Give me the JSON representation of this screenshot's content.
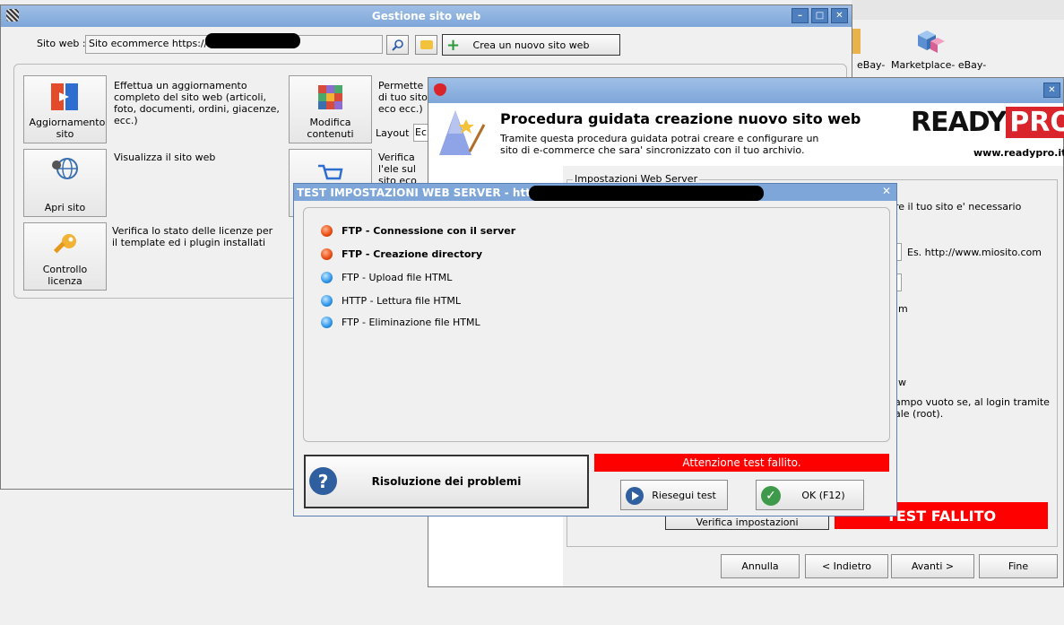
{
  "background_window": {
    "taskbar_icons": [
      {
        "label": "eBay-",
        "sub": ""
      },
      {
        "label": "Marketplace- eBay-",
        "sub": ""
      }
    ]
  },
  "main_window": {
    "title": "Gestione sito web",
    "site_label": "Sito web :",
    "site_value": "Sito ecommerce https://ww",
    "new_site_button": "Crea un nuovo sito web",
    "tiles": [
      {
        "label": "Aggiornamento sito",
        "desc": "Effettua un aggiornamento completo del sito web (articoli, foto, documenti, ordini, giacenze, ecc.)"
      },
      {
        "label": "Apri sito",
        "desc": "Visualizza il sito web"
      },
      {
        "label": "Controllo licenza",
        "desc": "Verifica lo stato delle licenze per il template ed i plugin installati"
      },
      {
        "label": "Modifica contenuti",
        "desc": "Permette di tuo sito eco ecc.)"
      },
      {
        "label": "",
        "desc": "Verifica l'ele sul sito eco"
      }
    ],
    "layout_label": "Layout :",
    "layout_value": "Ec"
  },
  "wizard": {
    "title": "Procedura guidata creazione nuovo sito web",
    "subtitle": "Tramite questa procedura guidata potrai creare e configurare un sito di e-commerce che sara' sincronizzato con il tuo archivio.",
    "brand_ready": "READY",
    "brand_pro": "PRO",
    "brand_url": "www.readypro.it",
    "group_title": "Impostazioni Web Server",
    "frag_text1": "re il tuo sito e' necessario",
    "frag_example": "Es. http://www.miosito.com",
    "frag_m": "m",
    "frag_w": "w",
    "frag_text2": "ampo vuoto se, al login tramite ale (root).",
    "verify_button": "Verifica impostazioni",
    "test_failed_banner": "TEST FALLITO",
    "buttons": {
      "cancel": "Annulla",
      "back": "< Indietro",
      "next": "Avanti >",
      "finish": "Fine"
    }
  },
  "test_dialog": {
    "title": "TEST IMPOSTAZIONI WEB SERVER - http:/",
    "tests": [
      {
        "label": "FTP - Connessione con il server",
        "status": "red",
        "bold": true
      },
      {
        "label": "FTP - Creazione directory",
        "status": "red",
        "bold": true
      },
      {
        "label": "FTP - Upload file HTML",
        "status": "blue",
        "bold": false
      },
      {
        "label": "HTTP - Lettura file HTML",
        "status": "blue",
        "bold": false
      },
      {
        "label": "FTP - Eliminazione file HTML",
        "status": "blue",
        "bold": false
      }
    ],
    "troubleshoot_button": "Risoluzione dei problemi",
    "status_message": "Attenzione test fallito.",
    "retry_button": "Riesegui test",
    "ok_button": "OK (F12)",
    "colors": {
      "fail": "#ff0000",
      "title_bg": "#7ea6d9"
    }
  }
}
